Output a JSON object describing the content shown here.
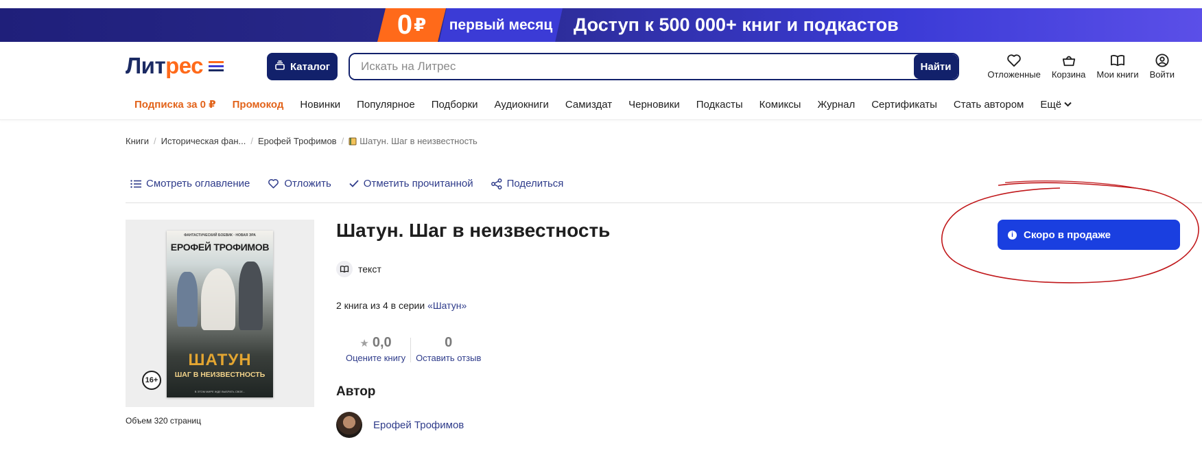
{
  "promo": {
    "zero": "0",
    "currency": "₽",
    "month": "первый месяц",
    "text": "Доступ к 500 000+ книг и подкастов"
  },
  "header": {
    "logo_part1": "Лит",
    "logo_part2": "рес",
    "catalog_label": "Каталог",
    "search_placeholder": "Искать на Литрес",
    "search_button": "Найти",
    "actions": {
      "deferred": "Отложенные",
      "cart": "Корзина",
      "my_books": "Мои книги",
      "login": "Войти"
    }
  },
  "nav": {
    "subscription": "Подписка за 0 ₽",
    "promo": "Промокод",
    "items": [
      "Новинки",
      "Популярное",
      "Подборки",
      "Аудиокниги",
      "Самиздат",
      "Черновики",
      "Подкасты",
      "Комиксы",
      "Журнал",
      "Сертификаты",
      "Стать автором"
    ],
    "more": "Ещё"
  },
  "breadcrumb": {
    "items": [
      "Книги",
      "Историческая фан...",
      "Ерофей Трофимов"
    ],
    "current": "Шатун. Шаг в неизвестность"
  },
  "actions": {
    "toc": "Смотреть оглавление",
    "defer": "Отложить",
    "mark_read": "Отметить прочитанной",
    "share": "Поделиться"
  },
  "book": {
    "title": "Шатун. Шаг в неизвестность",
    "format": "текст",
    "series_prefix": "2 книга из 4 в серии",
    "series_name": "«Шатун»",
    "rating_value": "0,0",
    "rating_label": "Оцените книгу",
    "reviews_count": "0",
    "reviews_label": "Оставить отзыв",
    "author_heading": "Автор",
    "author_name": "Ерофей Трофимов",
    "age_rating": "16+",
    "volume": "Объем 320 страниц",
    "cover": {
      "series": "ФАНТАСТИЧЕСКИЙ БОЕВИК · НОВАЯ ЭРА",
      "author": "ЕРОФЕЙ ТРОФИМОВ",
      "title": "ШАТУН",
      "subtitle": "ШАГ В НЕИЗВЕСТНОСТЬ",
      "tagline": "В ЭТОМ МИРЕ ЖДЕ ВЫБРАТЬ СВОЕ..."
    }
  },
  "status": {
    "soon_label": "Скоро в продаже"
  },
  "colors": {
    "brand_dark": "#12216b",
    "brand_orange": "#ff6a1a",
    "primary_button": "#1a3fe0",
    "link": "#2e3b8a",
    "annotation": "#c0171a"
  }
}
